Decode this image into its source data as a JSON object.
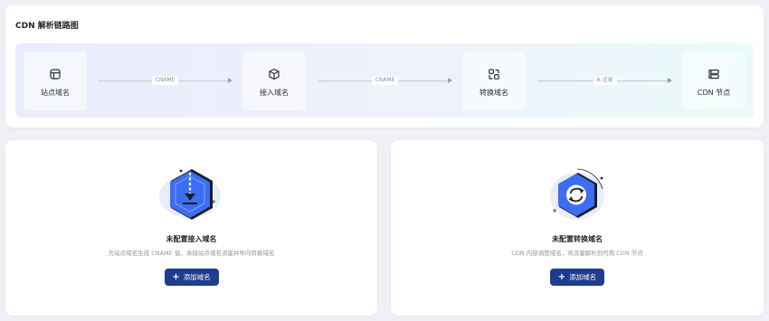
{
  "resolution_flow": {
    "title": "CDN 解析链路图",
    "nodes": [
      {
        "label": "站点域名",
        "icon": "site-domain-icon"
      },
      {
        "label": "接入域名",
        "icon": "access-domain-icon"
      },
      {
        "label": "转换域名",
        "icon": "convert-domain-icon"
      },
      {
        "label": "CDN 节点",
        "icon": "cdn-node-icon"
      }
    ],
    "edges": [
      {
        "label": "CNAME"
      },
      {
        "label": "CNAME"
      },
      {
        "label": "A 记录"
      }
    ]
  },
  "access_domain_panel": {
    "title": "未配置接入域名",
    "description": "为站点域名生成 CNAME 值，承接站点域名流量并导向转换域名",
    "button_label": "添加域名",
    "button_icon": "plus-icon"
  },
  "convert_domain_panel": {
    "title": "未配置转换域名",
    "description": "CDN 内部调度域名，将流量解析到可用 CDN 节点",
    "button_label": "添加域名",
    "button_icon": "plus-icon"
  },
  "colors": {
    "primary_button": "#1f3d8f",
    "illustration_blue": "#3d6df2",
    "page_background": "#eef0f5"
  }
}
